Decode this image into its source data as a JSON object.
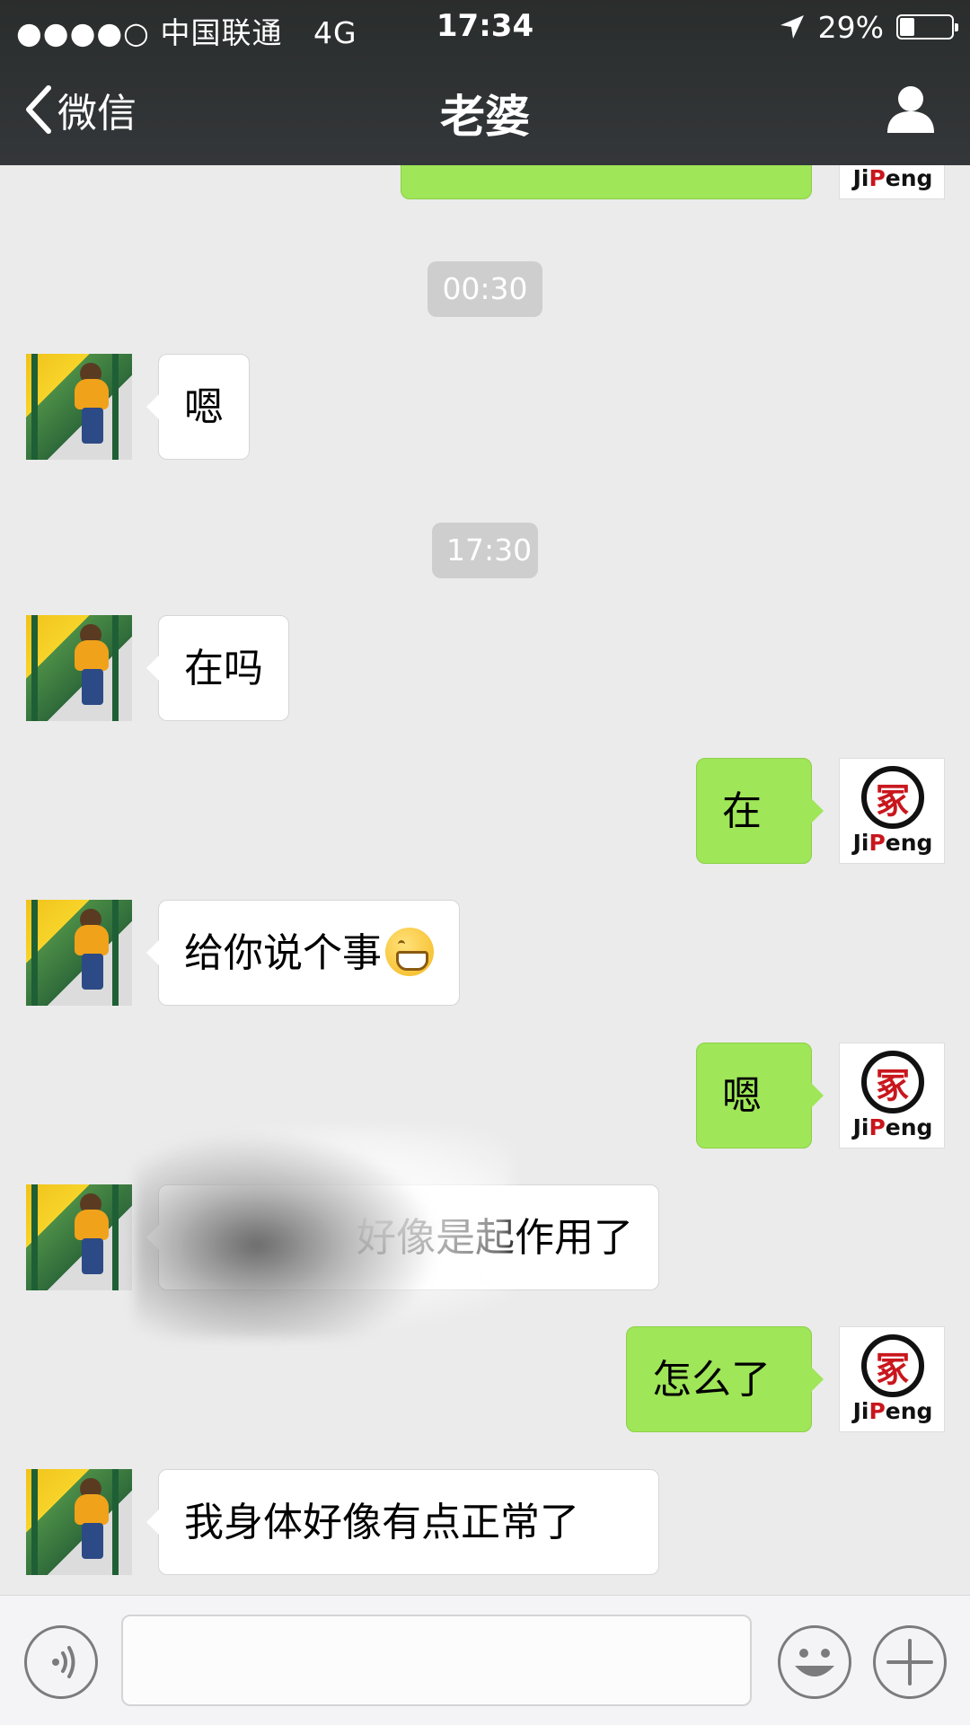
{
  "status_bar": {
    "signal": "●●●●○",
    "carrier": "中国联通",
    "network": "4G",
    "time": "17:34",
    "battery_percent": "29%",
    "battery_level": 0.29
  },
  "nav": {
    "back_label": "微信",
    "title": "老婆"
  },
  "avatars": {
    "me_brand_a": "Ji",
    "me_brand_b": "P",
    "me_brand_c": "eng"
  },
  "messages": {
    "t1": "00:30",
    "m1": "嗯",
    "t2": "17:30",
    "m2": "在吗",
    "m3": "在",
    "m4": "给你说个事",
    "m5": "嗯",
    "m6": "好像是起作用了",
    "m7": "怎么了",
    "m8": "我身体好像有点正常了"
  },
  "input": {
    "placeholder": ""
  },
  "icons": {
    "back": "chevron-left-icon",
    "profile": "person-icon",
    "voice": "voice-icon",
    "emoji": "smiley-icon",
    "plus": "plus-icon",
    "location": "location-arrow-icon"
  },
  "colors": {
    "nav_bg": "#2e3132",
    "chat_bg": "#ebebeb",
    "bubble_out": "#9fe658",
    "bubble_in": "#ffffff",
    "time_pill": "#cececf"
  }
}
